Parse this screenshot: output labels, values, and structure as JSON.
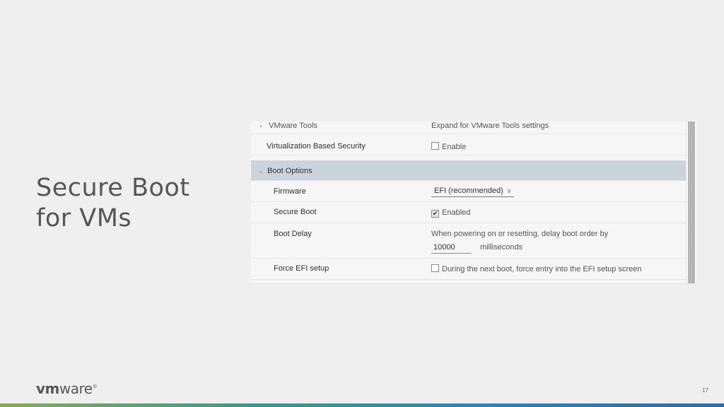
{
  "slide": {
    "title_line1": "Secure Boot",
    "title_line2": "for VMs",
    "page_number": "17",
    "logo_text_bold": "vm",
    "logo_text": "ware",
    "logo_mark": "®"
  },
  "settings": {
    "vmware_tools": {
      "label": "VMware Tools",
      "value": "Expand for VMware Tools settings"
    },
    "vbs": {
      "label": "Virtualization Based Security",
      "checkbox_label": "Enable",
      "checked": false
    },
    "boot_options": {
      "label": "Boot Options",
      "expanded": true
    },
    "firmware": {
      "label": "Firmware",
      "selected": "EFI (recommended)"
    },
    "secure_boot": {
      "label": "Secure Boot",
      "checkbox_label": "Enabled",
      "checked": true
    },
    "boot_delay": {
      "label": "Boot Delay",
      "description": "When powering on or resetting, delay boot order by",
      "value": "10000",
      "unit": "milliseconds"
    },
    "force_efi": {
      "label": "Force EFI setup",
      "checkbox_label": "During the next boot, force entry into the EFI setup screen",
      "checked": false
    }
  },
  "icons": {
    "chevron_right": "›",
    "chevron_down": "⌄",
    "caret_down": "∨",
    "check": "✔"
  },
  "colors": {
    "section_header_bg": "#cbd4db",
    "scroll_thumb": "#b5b5b5"
  }
}
